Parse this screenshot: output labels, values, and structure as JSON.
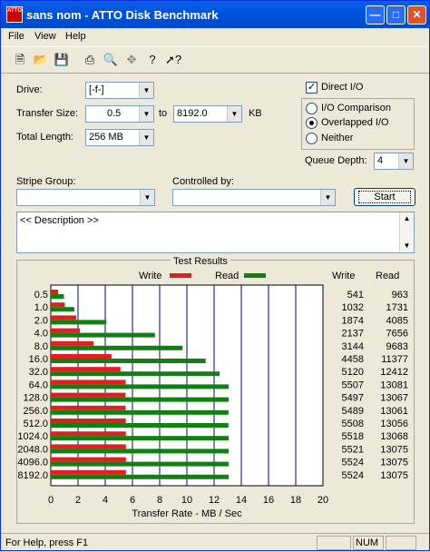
{
  "window": {
    "title": "sans nom - ATTO Disk Benchmark",
    "icon_text": "ATTO"
  },
  "menu": {
    "file": "File",
    "view": "View",
    "help": "Help"
  },
  "toolbar_icons": [
    "new-icon",
    "open-icon",
    "save-icon",
    "print-icon",
    "print-preview-icon",
    "move-icon",
    "help-icon",
    "context-help-icon"
  ],
  "form": {
    "drive_label": "Drive:",
    "drive_value": "[-f-]",
    "transfer_size_label": "Transfer Size:",
    "transfer_from": "0.5",
    "to_label": "to",
    "transfer_to": "8192.0",
    "kb_label": "KB",
    "total_length_label": "Total Length:",
    "total_length_value": "256 MB",
    "direct_io_label": "Direct I/O",
    "direct_io_checked": true,
    "io_comparison_label": "I/O Comparison",
    "overlapped_io_label": "Overlapped I/O",
    "neither_label": "Neither",
    "selected_mode": "overlapped",
    "queue_depth_label": "Queue Depth:",
    "queue_depth_value": "4",
    "stripe_group_label": "Stripe Group:",
    "controlled_by_label": "Controlled by:",
    "start_label": "Start",
    "description": "<< Description >>"
  },
  "results": {
    "title": "Test Results",
    "write_header": "Write",
    "read_header": "Read",
    "legend_write": "Write",
    "legend_read": "Read"
  },
  "chart_data": {
    "type": "bar",
    "orientation": "horizontal",
    "xlabel": "Transfer Rate - MB / Sec",
    "xlim": [
      0,
      20
    ],
    "xticks": [
      "0",
      "2",
      "4",
      "6",
      "8",
      "10",
      "12",
      "14",
      "16",
      "18",
      "20"
    ],
    "grid": true,
    "categories": [
      "0.5",
      "1.0",
      "2.0",
      "4.0",
      "8.0",
      "16.0",
      "32.0",
      "64.0",
      "128.0",
      "256.0",
      "512.0",
      "1024.0",
      "2048.0",
      "4096.0",
      "8192.0"
    ],
    "series": [
      {
        "name": "Write",
        "color": "#e02020",
        "values": [
          541,
          1032,
          1874,
          2137,
          3144,
          4458,
          5120,
          5507,
          5497,
          5489,
          5508,
          5518,
          5521,
          5524,
          5524
        ]
      },
      {
        "name": "Read",
        "color": "#108010",
        "values": [
          963,
          1731,
          4085,
          7656,
          9683,
          11377,
          12412,
          13081,
          13067,
          13061,
          13056,
          13068,
          13075,
          13075,
          13075
        ]
      }
    ],
    "write_text": [
      "541",
      "1032",
      "1874",
      "2137",
      "3144",
      "4458",
      "5120",
      "5507",
      "5497",
      "5489",
      "5508",
      "5518",
      "5521",
      "5524",
      "5524"
    ],
    "read_text": [
      "963",
      "1731",
      "4085",
      "7656",
      "9683",
      "11377",
      "12412",
      "13081",
      "13067",
      "13061",
      "13056",
      "13068",
      "13075",
      "13075",
      "13075"
    ]
  },
  "status": {
    "text": "For Help, press F1",
    "num": "NUM"
  }
}
